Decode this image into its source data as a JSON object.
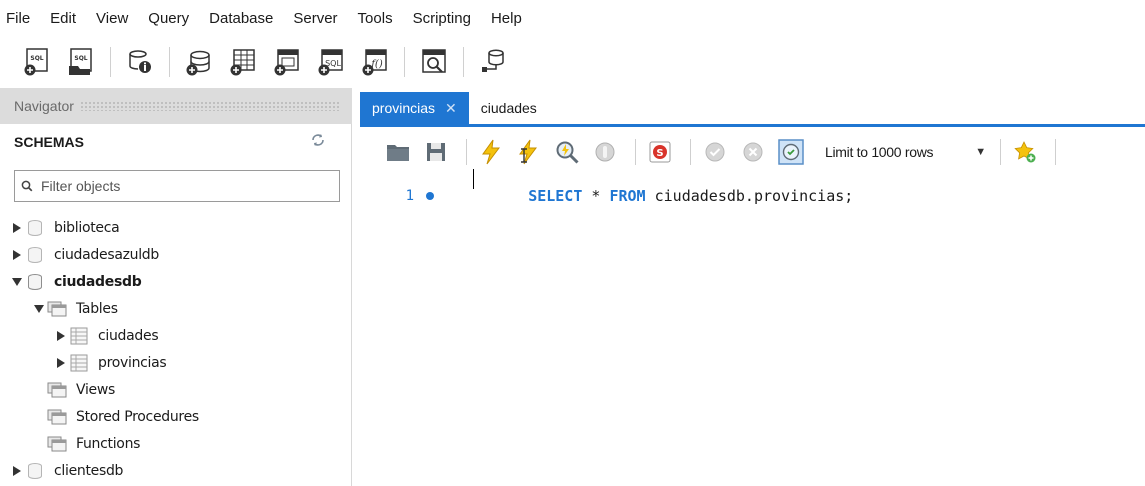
{
  "menu": [
    "File",
    "Edit",
    "View",
    "Query",
    "Database",
    "Server",
    "Tools",
    "Scripting",
    "Help"
  ],
  "navigator": {
    "header_label": "Navigator",
    "schemas_title": "SCHEMAS",
    "filter_placeholder": "Filter objects"
  },
  "tree": {
    "schemas": [
      {
        "label": "biblioteca"
      },
      {
        "label": "ciudadesazuldb"
      },
      {
        "label": "ciudadesdb"
      },
      {
        "label": "clientesdb"
      }
    ],
    "tables_label": "Tables",
    "tables": [
      {
        "label": "ciudades"
      },
      {
        "label": "provincias"
      }
    ],
    "views_label": "Views",
    "procedures_label": "Stored Procedures",
    "functions_label": "Functions"
  },
  "tabs": [
    {
      "label": "provincias",
      "active": true
    },
    {
      "label": "ciudades",
      "active": false
    }
  ],
  "editor_toolbar": {
    "limit_label": "Limit to 1000 rows"
  },
  "editor": {
    "line_number": "1",
    "kw_select": "SELECT",
    "star": " * ",
    "kw_from": "FROM",
    "target": " ciudadesdb.provincias;"
  },
  "colors": {
    "accent": "#1f76d2",
    "keyword": "#1f76d2",
    "navigator_header_bg": "#dcdcdc"
  }
}
